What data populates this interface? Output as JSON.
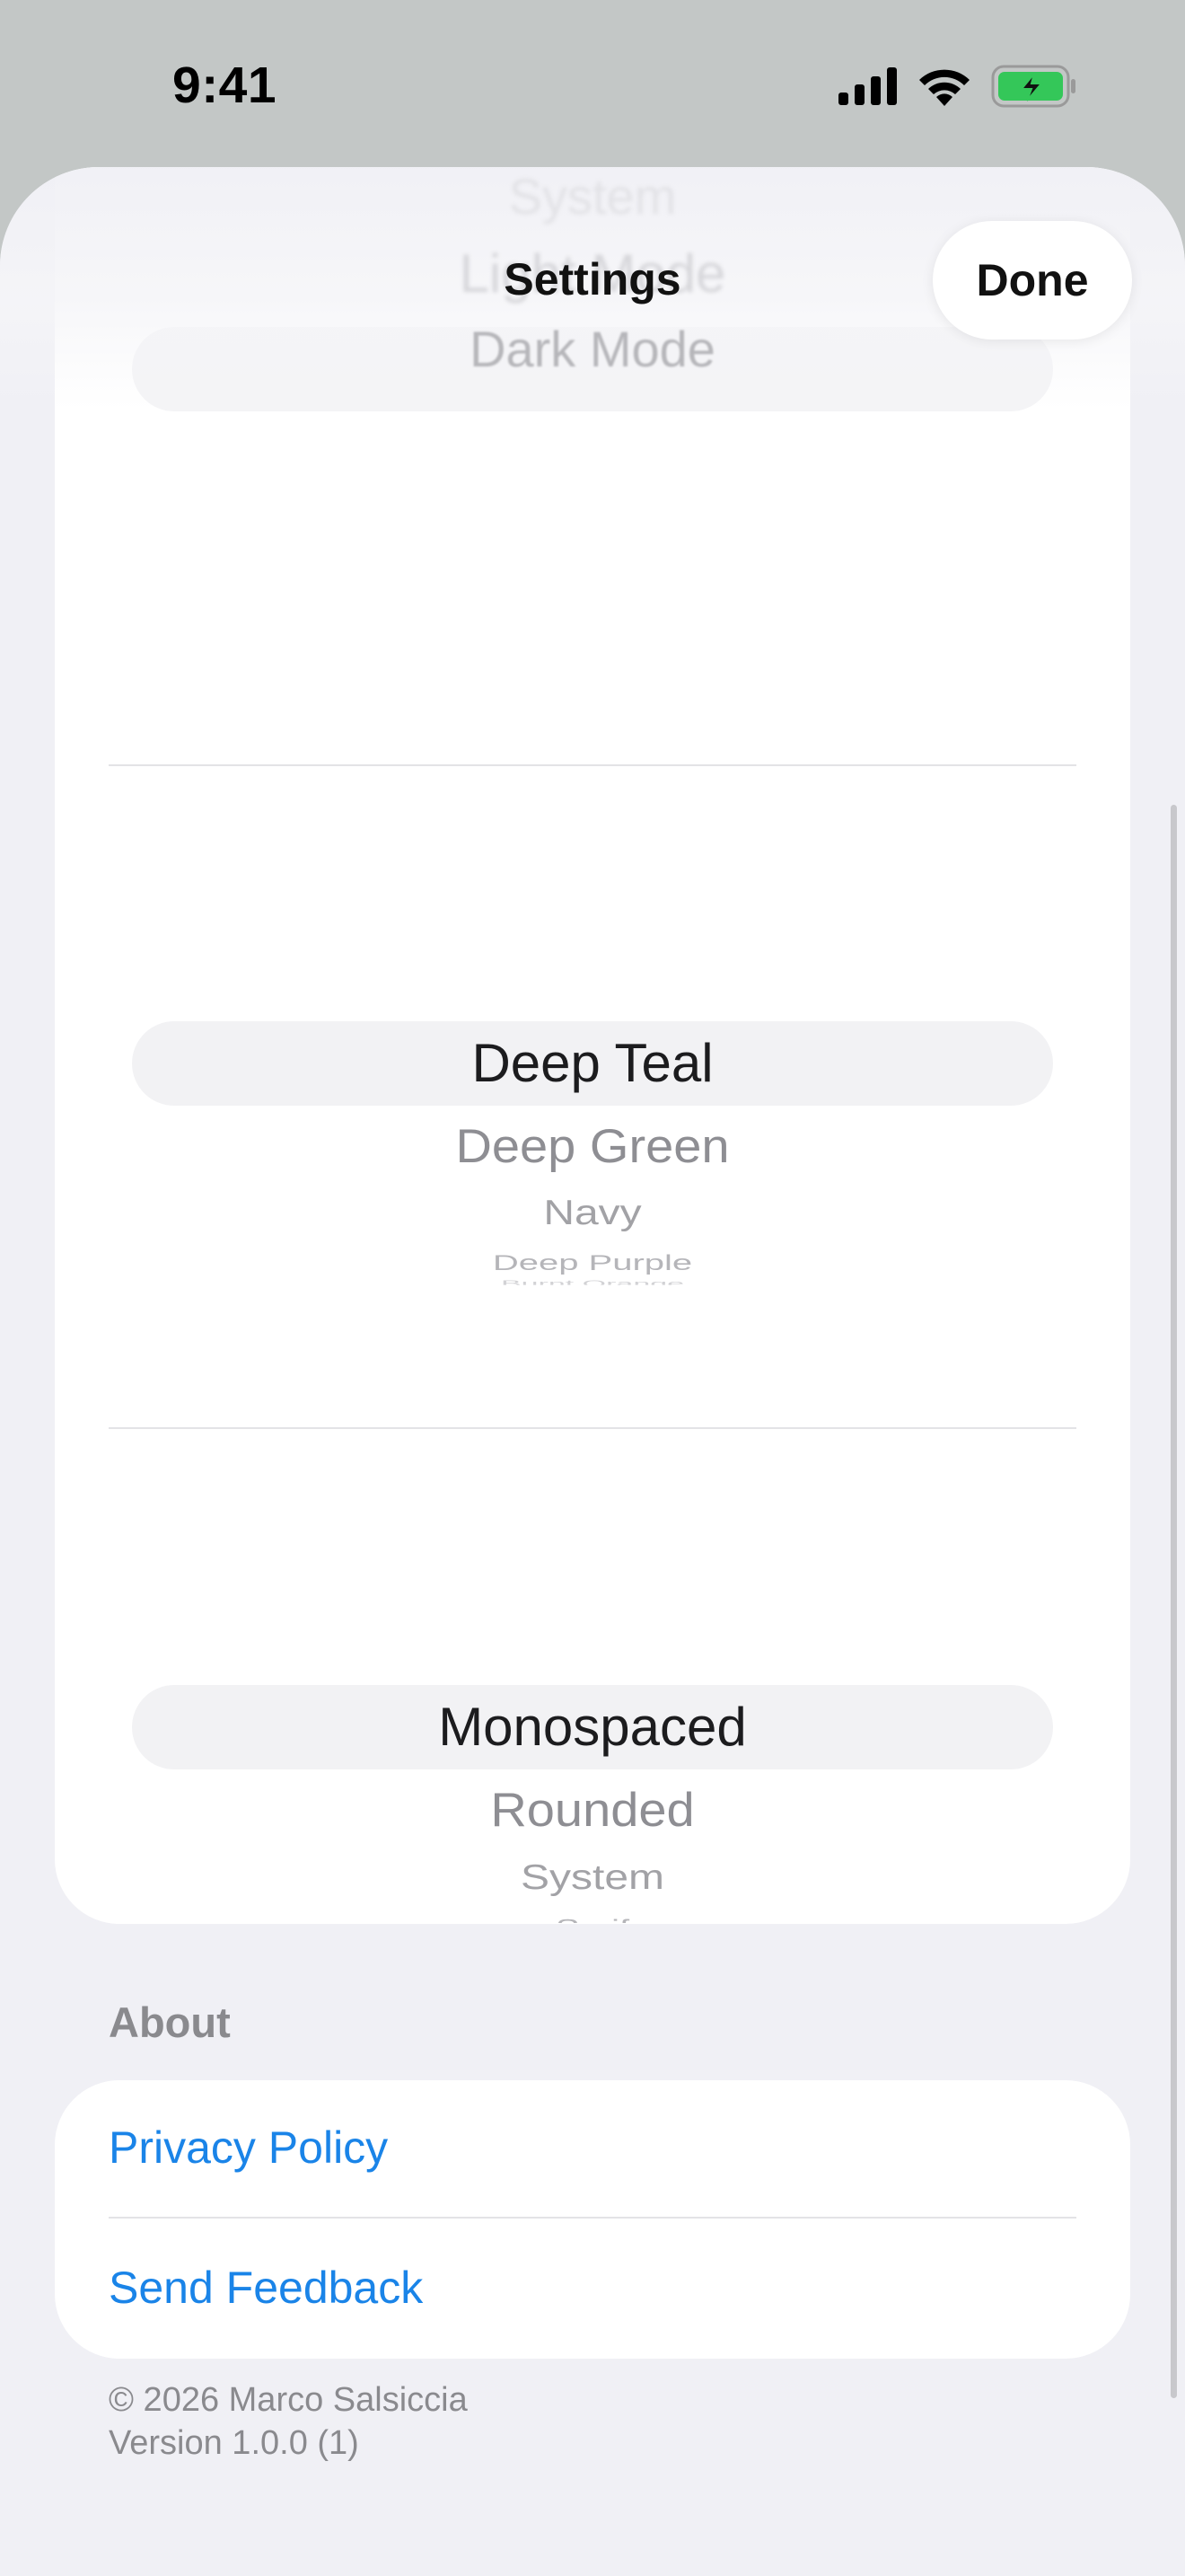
{
  "status_bar": {
    "time": "9:41",
    "icons": [
      "cellular-signal-icon",
      "wifi-icon",
      "battery-charging-icon"
    ],
    "battery_color": "#34c759"
  },
  "nav": {
    "title": "Settings",
    "done_label": "Done"
  },
  "appearance_picker": {
    "ghost_items": [
      "System",
      "Light Mode",
      "Dark Mode"
    ]
  },
  "color_picker": {
    "selected": "Deep Teal",
    "items": [
      "Deep Teal",
      "Deep Green",
      "Navy",
      "Deep Purple",
      "Burnt Orange"
    ]
  },
  "font_picker": {
    "selected": "Monospaced",
    "items": [
      "Monospaced",
      "Rounded",
      "System",
      "Serif"
    ]
  },
  "about": {
    "header": "About",
    "privacy_label": "Privacy Policy",
    "feedback_label": "Send Feedback"
  },
  "footer": {
    "copyright": "© 2026 Marco Salsiccia",
    "version": "Version 1.0.0 (1)"
  },
  "colors": {
    "link": "#1a84e8",
    "sheet_background": "#f0f0f5"
  }
}
